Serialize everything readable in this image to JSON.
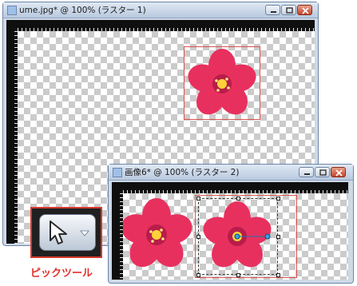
{
  "window1": {
    "title": "ume.jpg* @ 100% (ラスター 1)",
    "buttons": [
      "minimize-icon",
      "maximize-icon",
      "close-icon"
    ]
  },
  "window2": {
    "title": "画像6* @ 100% (ラスター 2)",
    "buttons": [
      "minimize-icon",
      "maximize-icon",
      "close-icon"
    ]
  },
  "tool": {
    "icon": "pick-tool-arrow-icon",
    "dropdown_icon": "dropdown-arrow-icon",
    "label": "ピックツール"
  },
  "colors": {
    "accent_red": "#d9382e",
    "blossom": "#e8305e",
    "blossom_center": "#ffd23a",
    "window_frame": "#cfd9e6"
  }
}
